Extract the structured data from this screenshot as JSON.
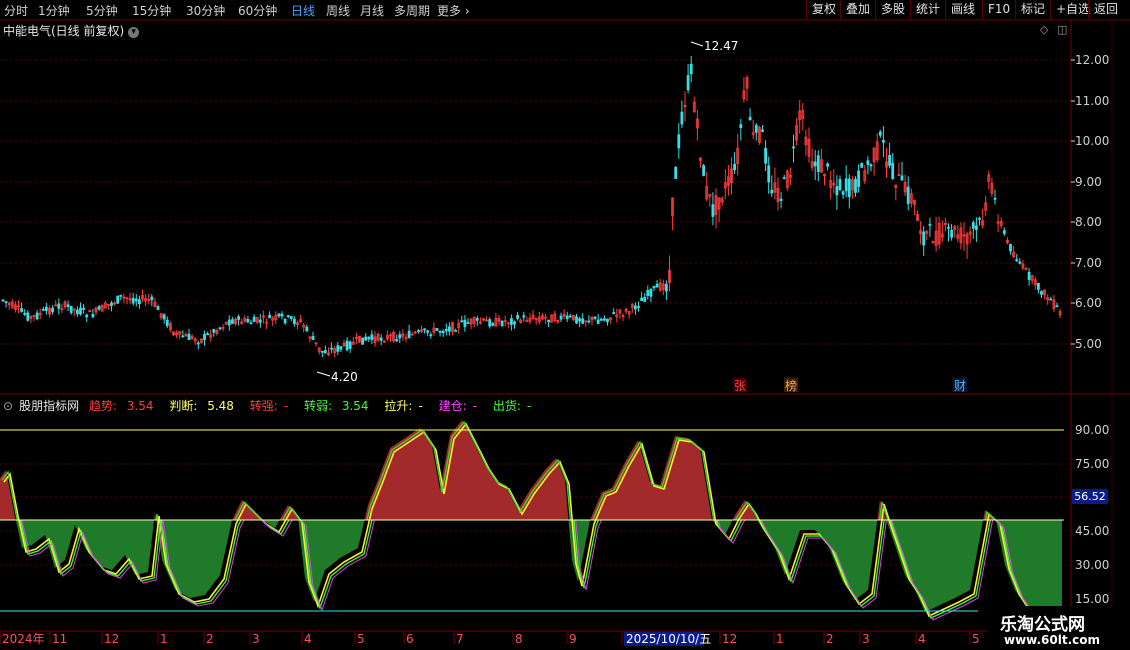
{
  "toolbar": {
    "periods": [
      "分时",
      "1分钟",
      "5分钟",
      "15分钟",
      "30分钟",
      "60分钟",
      "日线",
      "周线",
      "月线",
      "多周期",
      "更多"
    ],
    "active_period": "日线",
    "right_buttons": [
      "复权",
      "叠加",
      "多股",
      "统计",
      "画线",
      "F10",
      "标记",
      "+自选",
      "返回"
    ]
  },
  "main_chart": {
    "title": "中能电气(日线 前复权)",
    "price_axis": [
      "12.00",
      "11.00",
      "10.00",
      "9.00",
      "8.00",
      "7.00",
      "6.00",
      "5.00"
    ],
    "high_label": "12.47",
    "low_label": "4.20",
    "badges": [
      {
        "text": "张",
        "color": "#ff4040"
      },
      {
        "text": "榜",
        "color": "#ff9966"
      },
      {
        "text": "财",
        "color": "#66aaff"
      }
    ]
  },
  "indicator": {
    "name": "股朋指标网",
    "fields": [
      {
        "label": "趋势:",
        "value": "3.54",
        "color": "#ff3b3b"
      },
      {
        "label": "判断:",
        "value": "5.48",
        "color": "#ffff66"
      },
      {
        "label": "转强:",
        "value": "-",
        "color": "#ff3b3b"
      },
      {
        "label": "转弱:",
        "value": "3.54",
        "color": "#3cff3c"
      },
      {
        "label": "拉升:",
        "value": "-",
        "color": "#ffff66"
      },
      {
        "label": "建仓:",
        "value": "-",
        "color": "#ff44ff"
      },
      {
        "label": "出货:",
        "value": "-",
        "color": "#3cff3c"
      }
    ],
    "axis": [
      "90.00",
      "75.00",
      "45.00",
      "30.00",
      "15.00"
    ],
    "current_value": "56.52"
  },
  "time_axis": {
    "labels": [
      "2024年",
      "11",
      "12",
      "1",
      "2",
      "3",
      "4",
      "5",
      "6",
      "7",
      "8",
      "9",
      "2025/10/10/五",
      "12",
      "1",
      "2",
      "3",
      "4",
      "5"
    ]
  },
  "watermark": {
    "line1": "乐淘公式网",
    "line2": "www.60lt.com"
  },
  "colors": {
    "up": "#ff3b3b",
    "down": "#33e0e8",
    "grid": "#5a0000",
    "fill_red": "#a22a2a",
    "fill_green": "#1f7a2a"
  }
}
